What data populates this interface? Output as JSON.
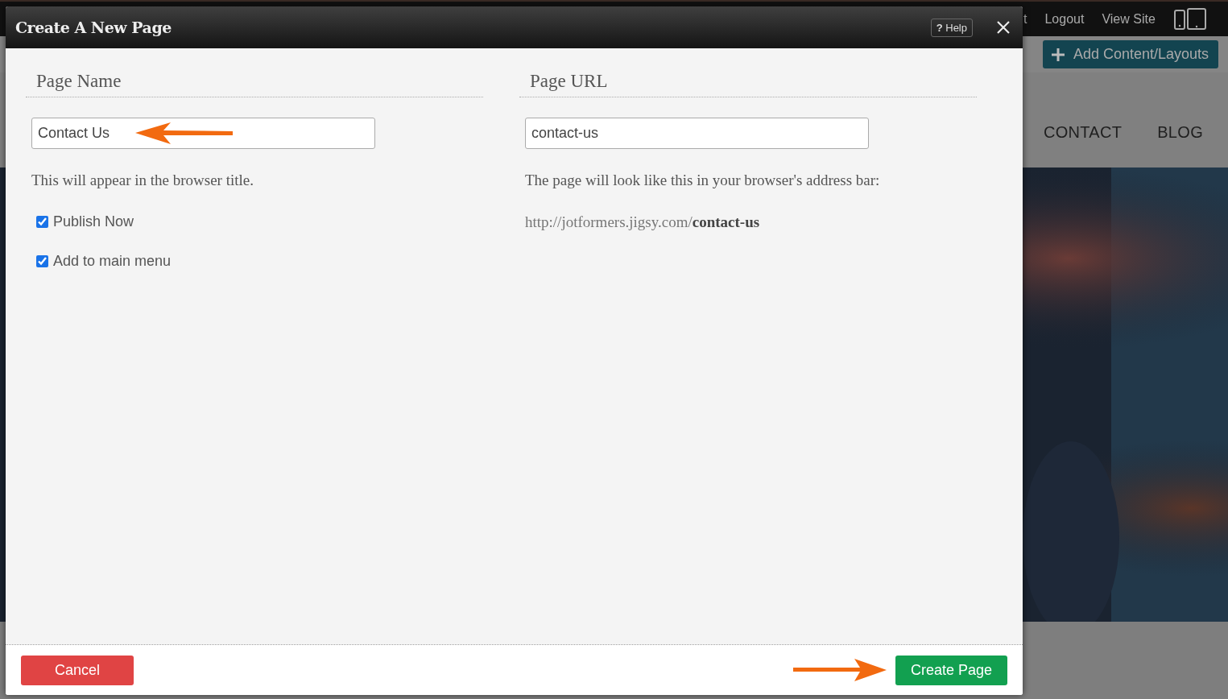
{
  "background": {
    "top_links": [
      "t",
      "Logout",
      "View Site"
    ],
    "add_button": "Add Content/Layouts",
    "nav": [
      "CONTACT",
      "BLOG"
    ],
    "hero": {
      "kind": "picture"
    }
  },
  "dialog": {
    "title": "Create A New Page",
    "help_icon": "?",
    "help": "Help",
    "name_section": {
      "heading": "Page Name",
      "value": "Contact Us",
      "hint": "This will appear in the browser title.",
      "options": [
        {
          "label": "Publish Now",
          "checked": true
        },
        {
          "label": "Add to main menu",
          "checked": true
        }
      ]
    },
    "url_section": {
      "heading": "Page URL",
      "value": "contact-us",
      "hint": "The page will look like this in your browser's address bar:",
      "preview": "http://jotformers.jigsy.com/**contact-us**"
    },
    "cancel": "Cancel",
    "create": "Create Page"
  }
}
